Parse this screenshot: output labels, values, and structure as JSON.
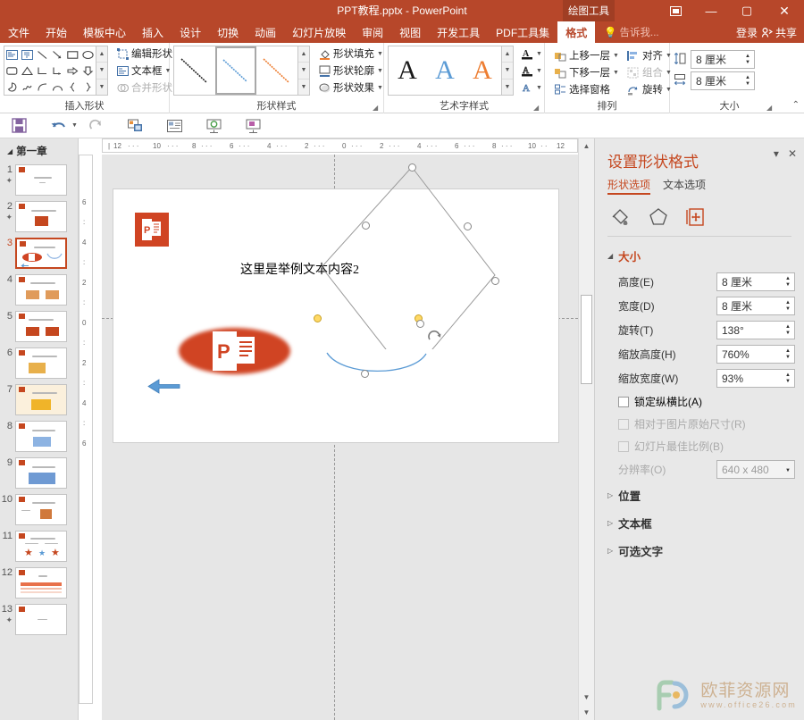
{
  "titlebar": {
    "document_title": "PPT教程.pptx - PowerPoint",
    "context_tab_group": "绘图工具",
    "ribbon_display_icon": "ribbon-display-options-icon",
    "minimize": "—",
    "maximize": "▢",
    "close": "✕"
  },
  "tabs": [
    {
      "label": "文件",
      "active": false
    },
    {
      "label": "开始",
      "active": false
    },
    {
      "label": "模板中心",
      "active": false
    },
    {
      "label": "插入",
      "active": false
    },
    {
      "label": "设计",
      "active": false
    },
    {
      "label": "切换",
      "active": false
    },
    {
      "label": "动画",
      "active": false
    },
    {
      "label": "幻灯片放映",
      "active": false
    },
    {
      "label": "审阅",
      "active": false
    },
    {
      "label": "视图",
      "active": false
    },
    {
      "label": "开发工具",
      "active": false
    },
    {
      "label": "PDF工具集",
      "active": false
    },
    {
      "label": "格式",
      "active": true
    }
  ],
  "tellme": {
    "label": "告诉我...",
    "icon": "lightbulb-icon"
  },
  "account": {
    "signin": "登录",
    "share": "共享",
    "share_icon": "person-share-icon"
  },
  "quick_access": [
    {
      "name": "save-icon",
      "glyph": "💾"
    },
    {
      "name": "undo-icon",
      "glyph": "↶"
    },
    {
      "name": "redo-icon",
      "glyph": "↷"
    },
    {
      "name": "start-from-beginning-icon",
      "glyph": "▣"
    },
    {
      "name": "new-slide-icon",
      "glyph": "▤"
    },
    {
      "name": "slideshow-icon",
      "glyph": "⊡"
    },
    {
      "name": "present-icon",
      "glyph": "⊞"
    }
  ],
  "ribbon": {
    "groups": [
      {
        "name": "insert-shapes",
        "label": "插入形状",
        "shapes": [
          "▣",
          "▥",
          "╲",
          "↘",
          "▭",
          "◯",
          "▢",
          "△",
          "⌐",
          "⌐",
          "⇨",
          "⇩",
          "◖",
          "ϟ",
          "⌒",
          "∩",
          "{",
          "}"
        ],
        "buttons": [
          {
            "label": "编辑形状",
            "icon": "edit-shape-icon",
            "caret": true,
            "disabled": false
          },
          {
            "label": "文本框",
            "icon": "text-box-icon",
            "caret": true,
            "disabled": false
          },
          {
            "label": "合并形状",
            "icon": "merge-shapes-icon",
            "caret": true,
            "disabled": true
          }
        ]
      },
      {
        "name": "shape-styles",
        "label": "形状样式",
        "gallery": [
          {
            "name": "style-dark-line",
            "color": "#262626",
            "selected": false
          },
          {
            "name": "style-blue-line",
            "color": "#5B9BD5",
            "selected": true
          },
          {
            "name": "style-orange-line",
            "color": "#ED7D31",
            "selected": false
          }
        ],
        "buttons": [
          {
            "label": "形状填充",
            "icon": "shape-fill-icon",
            "caret": true
          },
          {
            "label": "形状轮廓",
            "icon": "shape-outline-icon",
            "caret": true
          },
          {
            "label": "形状效果",
            "icon": "shape-effects-icon",
            "caret": true
          }
        ]
      },
      {
        "name": "wordart-styles",
        "label": "艺术字样式",
        "gallery": [
          {
            "name": "wordart-black-A",
            "letter": "A",
            "color": "#1a1a1a"
          },
          {
            "name": "wordart-blue-A",
            "letter": "A",
            "color": "#5B9BD5"
          },
          {
            "name": "wordart-orange-A",
            "letter": "A",
            "color": "#ED7D31"
          }
        ],
        "buttons": [
          {
            "name": "text-fill-icon",
            "letter": "A",
            "underline": "#1a1a1a"
          },
          {
            "name": "text-outline-icon",
            "letter": "A",
            "underline": "#1a1a1a"
          },
          {
            "name": "text-effects-icon",
            "letter": "A",
            "underline": ""
          }
        ]
      },
      {
        "name": "arrange",
        "label": "排列",
        "buttons": [
          {
            "label": "上移一层",
            "icon": "bring-forward-icon",
            "caret": true
          },
          {
            "label": "下移一层",
            "icon": "send-backward-icon",
            "caret": true
          },
          {
            "label": "选择窗格",
            "icon": "selection-pane-icon",
            "caret": false
          },
          {
            "label": "对齐",
            "icon": "align-icon",
            "caret": true
          },
          {
            "label": "组合",
            "icon": "group-icon",
            "caret": true,
            "disabled": true
          },
          {
            "label": "旋转",
            "icon": "rotate-icon",
            "caret": true
          }
        ]
      },
      {
        "name": "size",
        "label": "大小",
        "height": {
          "icon": "shape-height-icon",
          "value": "8 厘米"
        },
        "width": {
          "icon": "shape-width-icon",
          "value": "8 厘米"
        }
      }
    ],
    "collapse_icon": "collapse-ribbon-icon"
  },
  "thumbnails": {
    "section_label": "第一章",
    "slides": [
      {
        "num": "1",
        "star": true,
        "selected": false
      },
      {
        "num": "2",
        "star": true,
        "selected": false
      },
      {
        "num": "3",
        "star": false,
        "selected": true
      },
      {
        "num": "4",
        "star": false,
        "selected": false
      },
      {
        "num": "5",
        "star": false,
        "selected": false
      },
      {
        "num": "6",
        "star": false,
        "selected": false
      },
      {
        "num": "7",
        "star": false,
        "selected": false
      },
      {
        "num": "8",
        "star": false,
        "selected": false
      },
      {
        "num": "9",
        "star": false,
        "selected": false
      },
      {
        "num": "10",
        "star": false,
        "selected": false
      },
      {
        "num": "11",
        "star": false,
        "selected": false
      },
      {
        "num": "12",
        "star": false,
        "selected": false
      },
      {
        "num": "13",
        "star": true,
        "selected": false
      }
    ]
  },
  "rulers": {
    "horizontal": [
      "12",
      "10",
      "8",
      "6",
      "4",
      "2",
      "0",
      "2",
      "4",
      "6",
      "8",
      "10",
      "12"
    ],
    "vertical": [
      "6",
      "4",
      "2",
      "0",
      "2",
      "4",
      "6"
    ]
  },
  "slide": {
    "text_content": "这里是举例文本内容2",
    "ppt_logo_letter": "P",
    "arrow_color": "#5B9BD5",
    "ellipse_color": "#D04423",
    "selected_shape": "diamond-curve-shape",
    "curve_color": "#5B9BD5",
    "rotate_handle_icon": "rotate-handle-icon"
  },
  "format_pane": {
    "title": "设置形状格式",
    "collapse_icon": "pane-menu-icon",
    "close_icon": "pane-close-icon",
    "tabs": [
      {
        "label": "形状选项",
        "active": true
      },
      {
        "label": "文本选项",
        "active": false
      }
    ],
    "icon_tabs": [
      {
        "name": "fill-line-icon",
        "active": false
      },
      {
        "name": "effects-pentagon-icon",
        "active": false
      },
      {
        "name": "size-properties-icon",
        "active": true
      }
    ],
    "size_section": {
      "title": "大小",
      "expanded": true,
      "fields": [
        {
          "label": "高度(E)",
          "accel": "E",
          "value": "8 厘米",
          "disabled": false
        },
        {
          "label": "宽度(D)",
          "accel": "D",
          "value": "8 厘米",
          "disabled": false
        },
        {
          "label": "旋转(T)",
          "accel": "T",
          "value": "138°",
          "disabled": false
        },
        {
          "label": "缩放高度(H)",
          "accel": "H",
          "value": "760%",
          "disabled": false
        },
        {
          "label": "缩放宽度(W)",
          "accel": "W",
          "value": "93%",
          "disabled": false
        }
      ],
      "checkboxes": [
        {
          "label": "锁定纵横比(A)",
          "checked": false,
          "disabled": false
        },
        {
          "label": "相对于图片原始尺寸(R)",
          "checked": false,
          "disabled": true
        },
        {
          "label": "幻灯片最佳比例(B)",
          "checked": false,
          "disabled": true
        }
      ],
      "resolution": {
        "label": "分辨率(O)",
        "value": "640 x 480",
        "disabled": true
      }
    },
    "collapsed_sections": [
      {
        "title": "位置"
      },
      {
        "title": "文本框"
      },
      {
        "title": "可选文字"
      }
    ]
  },
  "watermark": {
    "brand": "欧菲资源网",
    "url": "www.office26.com",
    "logo_icon": "fo-logo-icon"
  },
  "colors": {
    "accent": "#B7472A",
    "accent_dark": "#A03E24",
    "pane_bg": "#E8E8E8",
    "thumb_bg": "#E6E6E6",
    "selected_orange": "#C5471F",
    "blue": "#5B9BD5",
    "ppt_red": "#D04423"
  }
}
